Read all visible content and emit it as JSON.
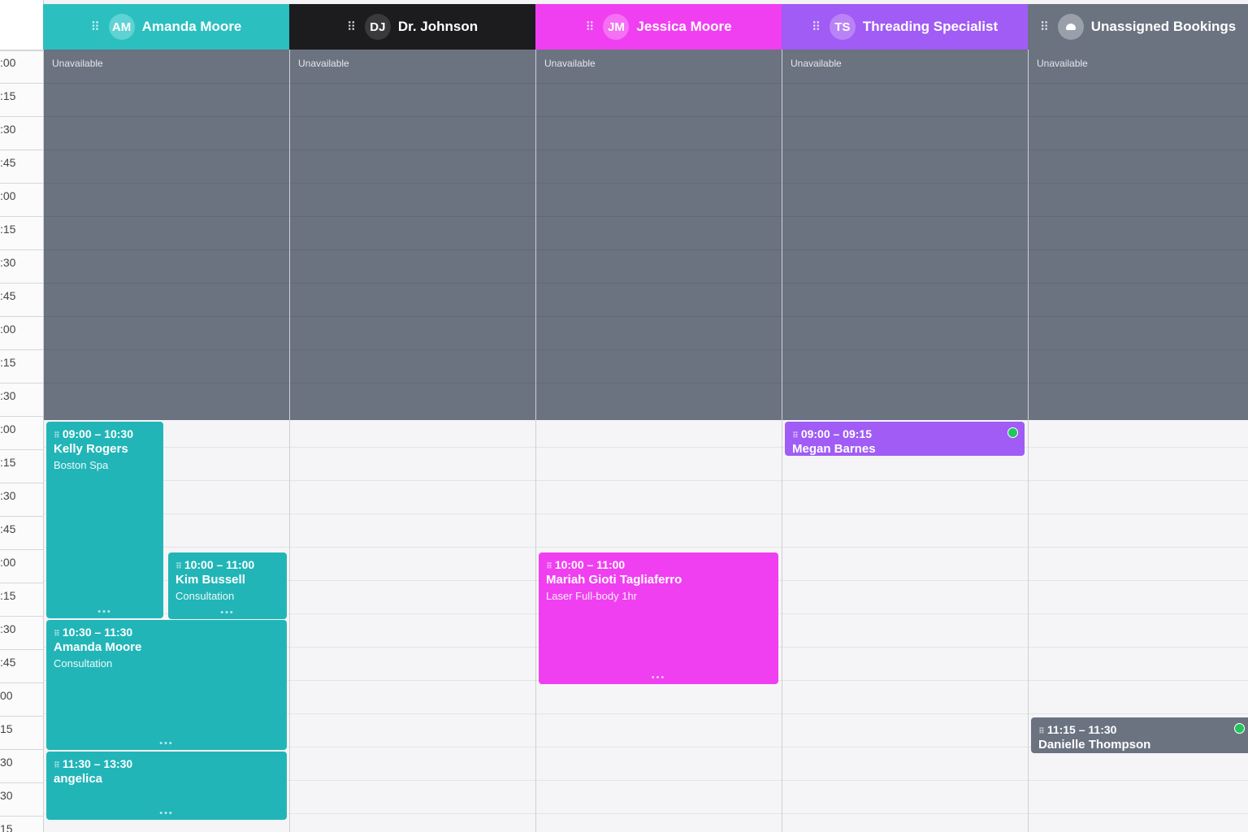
{
  "time_labels": [
    ":00",
    ":15",
    ":30",
    ":45",
    ":00",
    ":15",
    ":30",
    ":45",
    ":00",
    ":15",
    ":30",
    ":00",
    ":15",
    ":30",
    ":45",
    ":00",
    ":15",
    ":30",
    ":45",
    "00",
    "15",
    "30",
    "30",
    "15"
  ],
  "unavailable_label": "Unavailable",
  "columns": [
    {
      "id": "amanda-moore",
      "initials": "AM",
      "name": "Amanda Moore",
      "header_color": "#2bbfc0",
      "avatar_color": "#5fd2d3"
    },
    {
      "id": "dr-johnson",
      "initials": "DJ",
      "name": "Dr. Johnson",
      "header_color": "#1c1c1e",
      "avatar_color": "#3a3a3d"
    },
    {
      "id": "jessica-moore",
      "initials": "JM",
      "name": "Jessica Moore",
      "header_color": "#f03ff0",
      "avatar_color": "#f470f4"
    },
    {
      "id": "threading-specialist",
      "initials": "TS",
      "name": "Threading Specialist",
      "header_color": "#a05cf4",
      "avatar_color": "#b983f7"
    },
    {
      "id": "unassigned",
      "initials": "",
      "name": "Unassigned Bookings",
      "header_color": "#6b7280",
      "avatar_color": "#9aa0aa"
    }
  ],
  "events": [
    {
      "id": "kelly",
      "time": "09:00 – 10:30",
      "name": "Kelly Rogers",
      "service": "Boston Spa",
      "color": "#22b5b8",
      "status": false
    },
    {
      "id": "kim",
      "time": "10:00 – 11:00",
      "name": "Kim Bussell",
      "service": "Consultation",
      "color": "#22b5b8",
      "status": false
    },
    {
      "id": "amanda",
      "time": "10:30 – 11:30",
      "name": "Amanda Moore",
      "service": "Consultation",
      "color": "#22b5b8",
      "status": false
    },
    {
      "id": "angelica",
      "time": "11:30 – 13:30",
      "name": "angelica",
      "service": "",
      "color": "#22b5b8",
      "status": false
    },
    {
      "id": "mariah",
      "time": "10:00 – 11:00",
      "name": "Mariah Gioti Tagliaferro",
      "service": "Laser Full-body 1hr",
      "color": "#f03ff0",
      "status": false
    },
    {
      "id": "megan",
      "time": "09:00 – 09:15",
      "name": "Megan Barnes",
      "service": "",
      "color": "#a05cf4",
      "status": true
    },
    {
      "id": "danielle",
      "time": "11:15 – 11:30",
      "name": "Danielle Thompson",
      "service": "",
      "color": "#6b7280",
      "status": true
    }
  ]
}
